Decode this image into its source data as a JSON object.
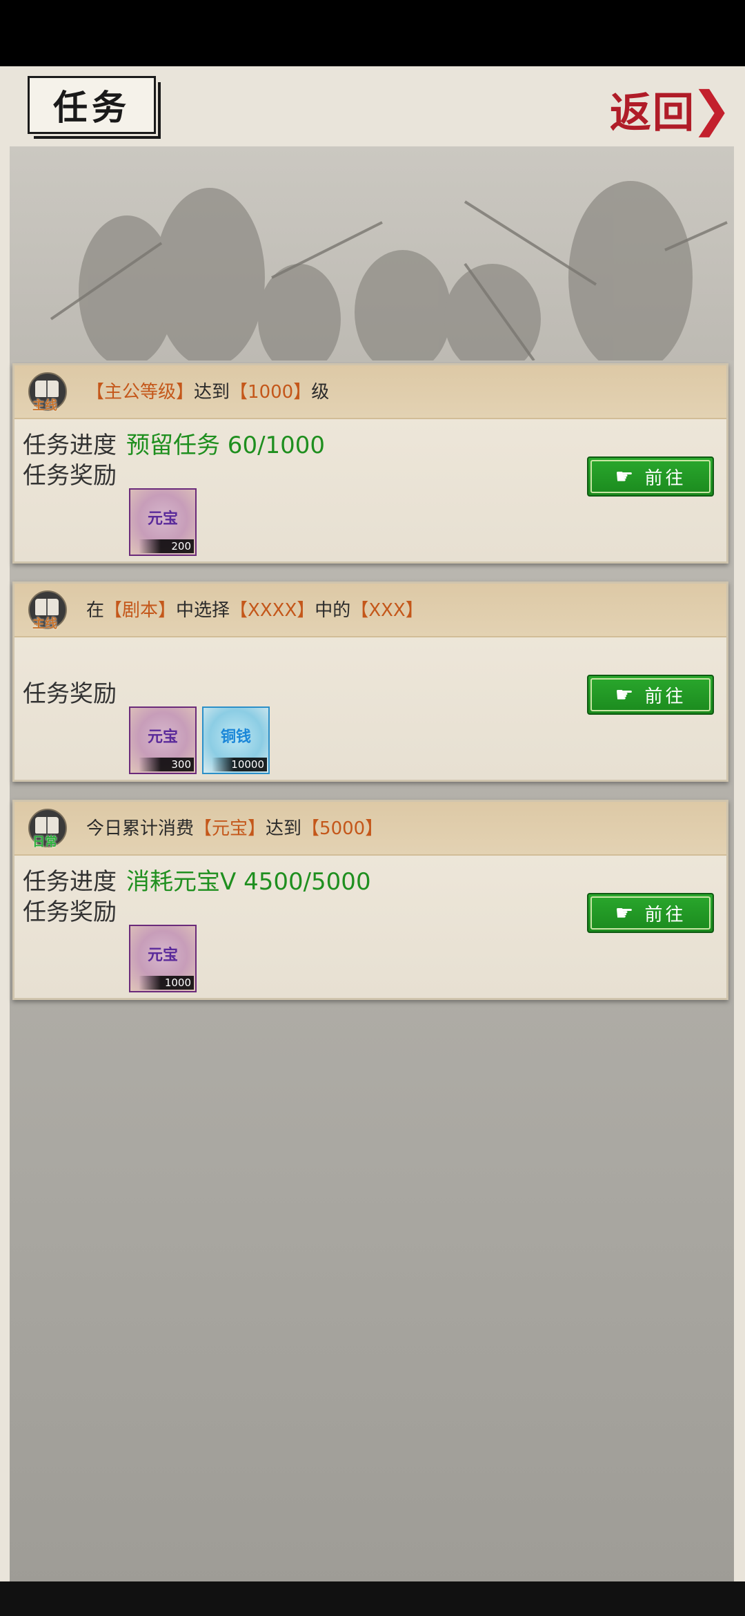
{
  "header": {
    "title": "任务",
    "back_label": "返回",
    "back_chevron": "❯"
  },
  "tasks": [
    {
      "tag": "主线",
      "title_parts": [
        "【主公等级】",
        "达到",
        "【1000】",
        "级"
      ],
      "progress_label": "任务进度",
      "progress_value": "预留任务 60/1000",
      "reward_label": "任务奖励",
      "rewards": [
        {
          "name": "元宝",
          "count": "200",
          "kind": "yuanbao"
        }
      ],
      "button_label": "前往"
    },
    {
      "tag": "主线",
      "title_parts": [
        "在",
        "【剧本】",
        "中选择",
        "【XXXX】",
        "中的",
        "【XXX】"
      ],
      "progress_label": "",
      "progress_value": "",
      "reward_label": "任务奖励",
      "rewards": [
        {
          "name": "元宝",
          "count": "300",
          "kind": "yuanbao"
        },
        {
          "name": "铜钱",
          "count": "10000",
          "kind": "tongqian"
        }
      ],
      "button_label": "前往"
    },
    {
      "tag": "日常",
      "title_parts": [
        "今日累计消费",
        "【元宝】",
        "达到",
        "【5000】"
      ],
      "progress_label": "任务进度",
      "progress_value": "消耗元宝V 4500/5000",
      "reward_label": "任务奖励",
      "rewards": [
        {
          "name": "元宝",
          "count": "1000",
          "kind": "yuanbao"
        }
      ],
      "button_label": "前往"
    }
  ],
  "colors": {
    "highlight": "#c4571a",
    "progress_green": "#1f8f1f",
    "button_green": "#1b8a1e",
    "back_red": "#b01c28"
  }
}
